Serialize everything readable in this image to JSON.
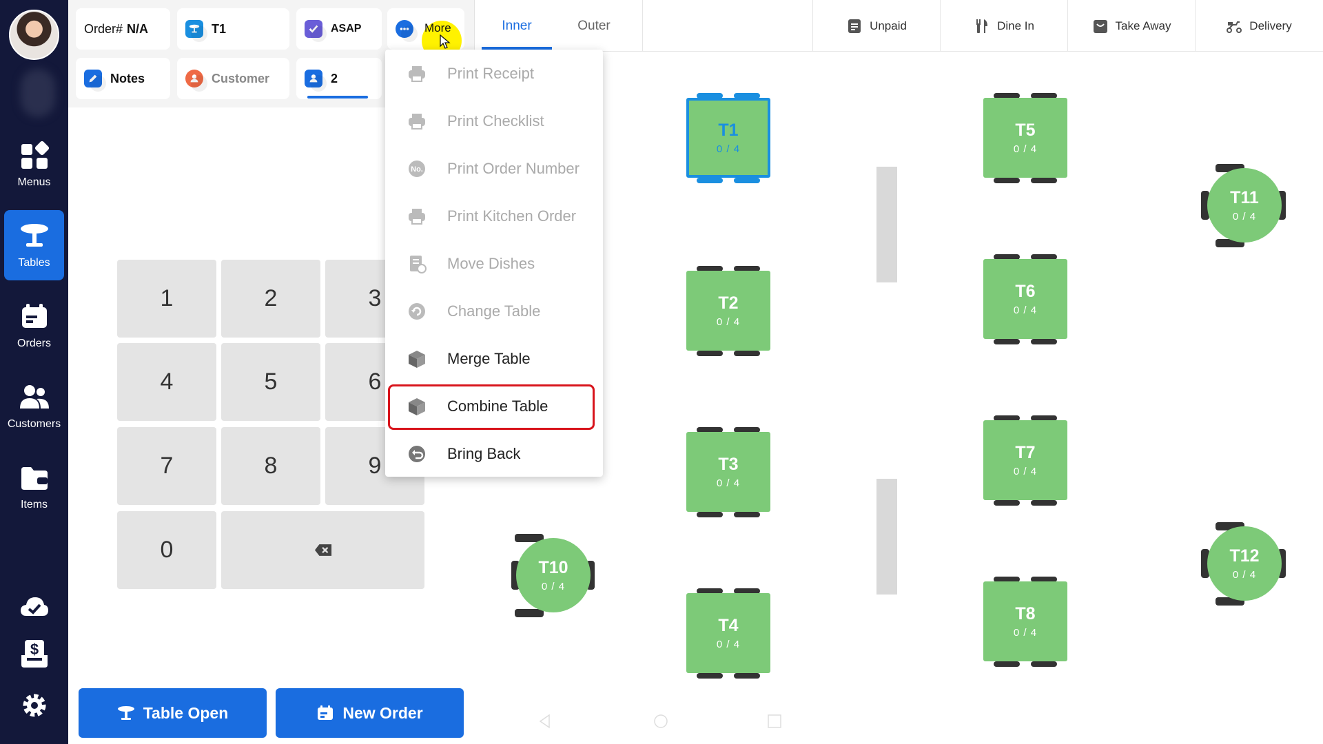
{
  "sidebar": {
    "items": [
      {
        "label": "Menus",
        "icon": "grid-icon"
      },
      {
        "label": "Tables",
        "icon": "table-icon",
        "active": true
      },
      {
        "label": "Orders",
        "icon": "orders-icon"
      },
      {
        "label": "Customers",
        "icon": "customers-icon"
      },
      {
        "label": "Items",
        "icon": "folder-icon"
      }
    ],
    "bottom_icons": [
      "cloud-check-icon",
      "cash-drawer-icon",
      "gear-icon"
    ]
  },
  "order_panel": {
    "order_label": "Order#",
    "order_value": "N/A",
    "table": "T1",
    "timing": "ASAP",
    "more": "More",
    "notes": "Notes",
    "customer": "Customer",
    "guests": "2"
  },
  "keypad": {
    "keys": [
      "1",
      "2",
      "3",
      "4",
      "5",
      "6",
      "7",
      "8",
      "9",
      "0"
    ],
    "backspace_icon": "backspace-icon"
  },
  "actions": {
    "table_open": "Table Open",
    "new_order": "New Order"
  },
  "floor_tabs": [
    {
      "label": "Inner",
      "active": true
    },
    {
      "label": "Outer",
      "active": false
    }
  ],
  "filters": [
    {
      "label": "Unpaid",
      "icon": "receipt-icon"
    },
    {
      "label": "Dine In",
      "icon": "utensils-icon"
    },
    {
      "label": "Take Away",
      "icon": "bag-icon"
    },
    {
      "label": "Delivery",
      "icon": "scooter-icon"
    }
  ],
  "tables": [
    {
      "name": "T1",
      "capacity": "0 / 4",
      "selected": true
    },
    {
      "name": "T2",
      "capacity": "0 / 4"
    },
    {
      "name": "T3",
      "capacity": "0 / 4"
    },
    {
      "name": "T4",
      "capacity": "0 / 4"
    },
    {
      "name": "T5",
      "capacity": "0 / 4"
    },
    {
      "name": "T6",
      "capacity": "0 / 4"
    },
    {
      "name": "T7",
      "capacity": "0 / 4"
    },
    {
      "name": "T8",
      "capacity": "0 / 4"
    },
    {
      "name": "T10",
      "capacity": "0 / 4"
    },
    {
      "name": "T11",
      "capacity": "0 / 4"
    },
    {
      "name": "T12",
      "capacity": "0 / 4"
    }
  ],
  "more_menu": [
    {
      "label": "Print Receipt",
      "enabled": false,
      "icon": "printer-icon"
    },
    {
      "label": "Print Checklist",
      "enabled": false,
      "icon": "printer-icon"
    },
    {
      "label": "Print Order Number",
      "enabled": false,
      "icon": "order-number-icon"
    },
    {
      "label": "Print Kitchen Order",
      "enabled": false,
      "icon": "printer-icon"
    },
    {
      "label": "Move Dishes",
      "enabled": false,
      "icon": "move-dishes-icon"
    },
    {
      "label": "Change Table",
      "enabled": false,
      "icon": "refresh-icon"
    },
    {
      "label": "Merge Table",
      "enabled": true,
      "icon": "box-icon"
    },
    {
      "label": "Combine Table",
      "enabled": true,
      "icon": "box-icon",
      "highlighted": true
    },
    {
      "label": "Bring Back",
      "enabled": true,
      "icon": "undo-icon"
    }
  ],
  "colors": {
    "sidebar_bg": "#13183a",
    "accent": "#1a6de0",
    "table_green": "#7dca78",
    "selected_blue": "#1a8fe0",
    "highlight_red": "#d8141c"
  }
}
